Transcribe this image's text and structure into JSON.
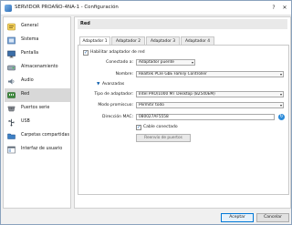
{
  "window": {
    "title": "SERVIDOR PROAÑO-4NA-1 - Configuración",
    "help_label": "?",
    "close_label": "✕"
  },
  "sidebar": {
    "items": [
      {
        "label": "General",
        "icon": "general-icon",
        "selected": false
      },
      {
        "label": "Sistema",
        "icon": "system-icon",
        "selected": false
      },
      {
        "label": "Pantalla",
        "icon": "display-icon",
        "selected": false
      },
      {
        "label": "Almacenamiento",
        "icon": "storage-icon",
        "selected": false
      },
      {
        "label": "Audio",
        "icon": "audio-icon",
        "selected": false
      },
      {
        "label": "Red",
        "icon": "network-icon",
        "selected": true
      },
      {
        "label": "Puertos serie",
        "icon": "serial-ports-icon",
        "selected": false
      },
      {
        "label": "USB",
        "icon": "usb-icon",
        "selected": false
      },
      {
        "label": "Carpetas compartidas",
        "icon": "shared-folders-icon",
        "selected": false
      },
      {
        "label": "Interfaz de usuario",
        "icon": "user-interface-icon",
        "selected": false
      }
    ]
  },
  "main": {
    "section_title": "Red",
    "tabs": [
      {
        "label": "Adaptador 1",
        "active": true
      },
      {
        "label": "Adaptador 2",
        "active": false
      },
      {
        "label": "Adaptador 3",
        "active": false
      },
      {
        "label": "Adaptador 4",
        "active": false
      }
    ],
    "adapter": {
      "enable_label": "Habilitar adaptador de red",
      "enable_checked": true,
      "attached_label": "Conectado a:",
      "attached_value": "Adaptador puente",
      "name_label": "Nombre:",
      "name_value": "Realtek PCIe GbE Family Controller",
      "advanced_label": "Avanzadas",
      "adapter_type_label": "Tipo de adaptador:",
      "adapter_type_value": "Intel PRO/1000 MT Desktop (82540EM)",
      "promiscuous_label": "Modo promiscuo:",
      "promiscuous_value": "Permitir todo",
      "mac_label": "Dirección MAC:",
      "mac_value": "080027AF5558",
      "cable_label": "Cable conectado",
      "cable_checked": true,
      "port_forwarding_label": "Reenvío de puertos"
    }
  },
  "footer": {
    "accept_label": "Aceptar",
    "cancel_label": "Cancelar"
  },
  "colors": {
    "accent": "#0078d7",
    "selected_row": "#d8d8d8"
  }
}
